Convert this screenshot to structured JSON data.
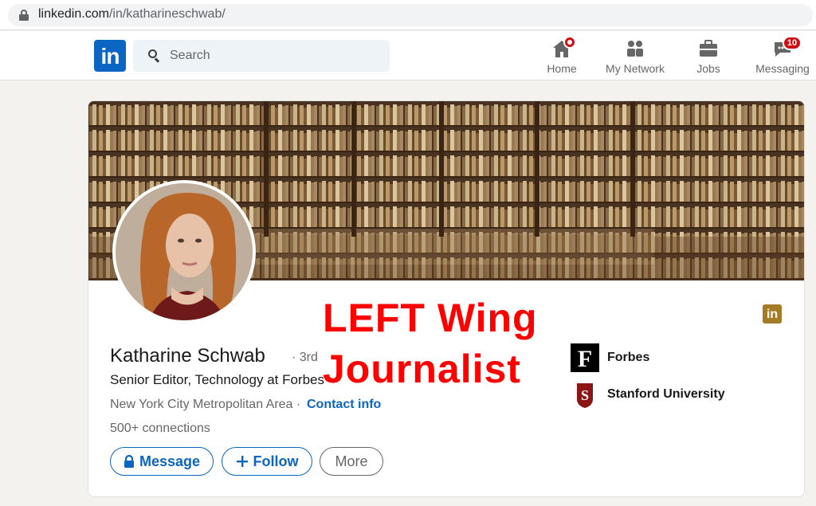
{
  "browser": {
    "url_host": "linkedin.com",
    "url_path": "/in/katharineschwab/"
  },
  "nav": {
    "logo_text": "in",
    "search_placeholder": "Search",
    "items": [
      {
        "label": "Home",
        "icon": "home-icon",
        "badge": ""
      },
      {
        "label": "My Network",
        "icon": "network-icon",
        "badge": ""
      },
      {
        "label": "Jobs",
        "icon": "briefcase-icon",
        "badge": ""
      },
      {
        "label": "Messaging",
        "icon": "messaging-icon",
        "badge": "10"
      }
    ]
  },
  "profile": {
    "name": "Katharine Schwab",
    "degree": "· 3rd",
    "headline": "Senior Editor, Technology at Forbes",
    "location": "New York City Metropolitan Area ·",
    "contact_info": "Contact info",
    "connections": "500+ connections",
    "buttons": {
      "message": "Message",
      "follow": "Follow",
      "more": "More"
    },
    "organizations": [
      {
        "name": "Forbes",
        "logo_letter": "F"
      },
      {
        "name": "Stanford University",
        "logo_letter": "S"
      }
    ]
  },
  "overlay": {
    "line1": "LEFT Wing",
    "line2": "Journalist"
  },
  "colors": {
    "linkedin_blue": "#0a66c2",
    "badge_red": "#cc1016",
    "overlay_red": "#ff0000",
    "stanford_red": "#8c1515"
  }
}
